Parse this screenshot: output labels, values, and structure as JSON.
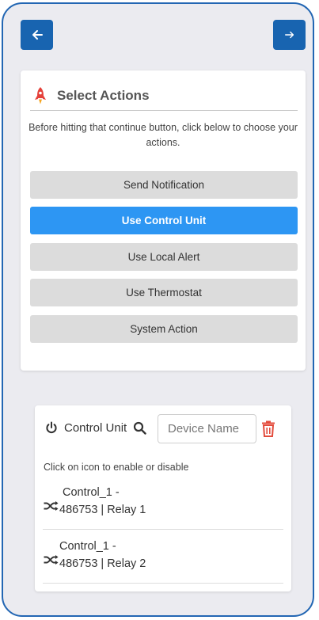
{
  "nav": {
    "back_icon": "arrow-left-icon",
    "next_icon": "arrow-right-icon"
  },
  "actions": {
    "icon": "rocket-icon",
    "title": "Select Actions",
    "description": "Before hitting that continue button, click below to choose your actions.",
    "buttons": [
      {
        "label": "Send Notification",
        "active": false
      },
      {
        "label": "Use Control Unit",
        "active": true
      },
      {
        "label": "Use Local Alert",
        "active": false
      },
      {
        "label": "Use Thermostat",
        "active": false
      },
      {
        "label": "System Action",
        "active": false
      }
    ],
    "active_color": "#2d96f3"
  },
  "control_unit": {
    "icon": "power-icon",
    "title": "Control Unit",
    "search_icon": "search-icon",
    "search_placeholder": "Device Name",
    "delete_icon": "trash-icon",
    "hint": "Click on icon to enable or disable",
    "devices": [
      {
        "line1": "Control_1 -",
        "line2": "486753 | Relay 1",
        "icon": "shuffle-icon"
      },
      {
        "line1": "Control_1 -",
        "line2": "486753 | Relay 2",
        "icon": "shuffle-icon"
      }
    ]
  },
  "colors": {
    "primary": "#1864b0",
    "danger": "#e34b3c",
    "frame": "#2266b3"
  }
}
